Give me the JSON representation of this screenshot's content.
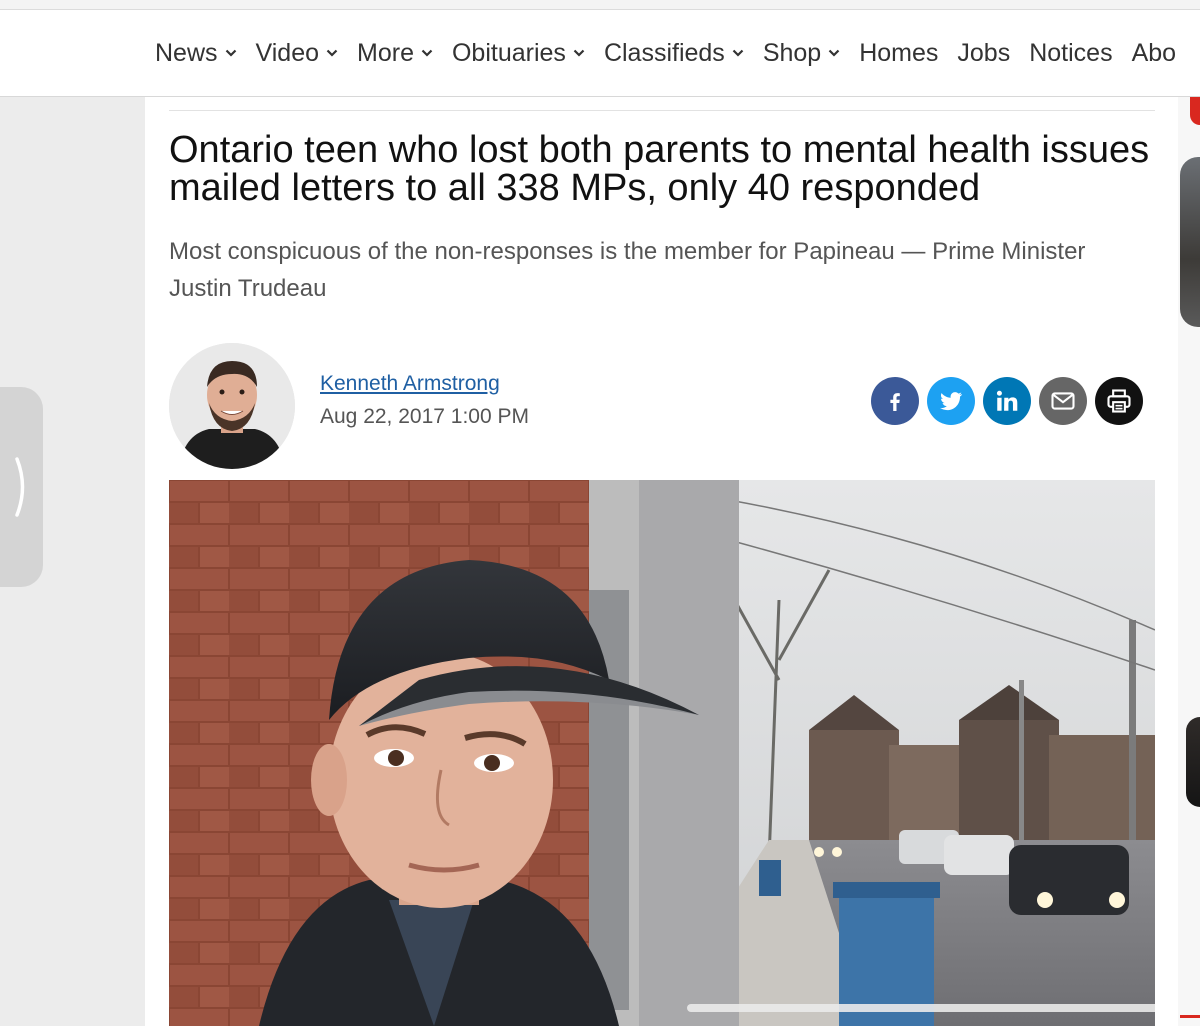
{
  "nav": {
    "items": [
      {
        "label": "News",
        "dropdown": true
      },
      {
        "label": "Video",
        "dropdown": true
      },
      {
        "label": "More",
        "dropdown": true
      },
      {
        "label": "Obituaries",
        "dropdown": true
      },
      {
        "label": "Classifieds",
        "dropdown": true
      },
      {
        "label": "Shop",
        "dropdown": true
      },
      {
        "label": "Homes",
        "dropdown": false
      },
      {
        "label": "Jobs",
        "dropdown": false
      },
      {
        "label": "Notices",
        "dropdown": false
      },
      {
        "label": "Abo",
        "dropdown": false
      }
    ]
  },
  "article": {
    "headline": "Ontario teen who lost both parents to mental health issues mailed letters to all 338 MPs, only 40 responded",
    "subhead": "Most conspicuous of the non-responses is the member for Papineau — Prime Minister Justin Trudeau",
    "author": "Kenneth Armstrong",
    "date": "Aug 22, 2017 1:00 PM"
  },
  "share": [
    {
      "network": "facebook",
      "icon": "facebook-icon",
      "color": "#3b5998"
    },
    {
      "network": "twitter",
      "icon": "twitter-icon",
      "color": "#1da1f2"
    },
    {
      "network": "linkedin",
      "icon": "linkedin-icon",
      "color": "#0077b5"
    },
    {
      "network": "email",
      "icon": "email-icon",
      "color": "#666666"
    },
    {
      "network": "print",
      "icon": "print-icon",
      "color": "#111111"
    }
  ],
  "colors": {
    "accent": "#d9281f",
    "link": "#1f5fa3"
  }
}
